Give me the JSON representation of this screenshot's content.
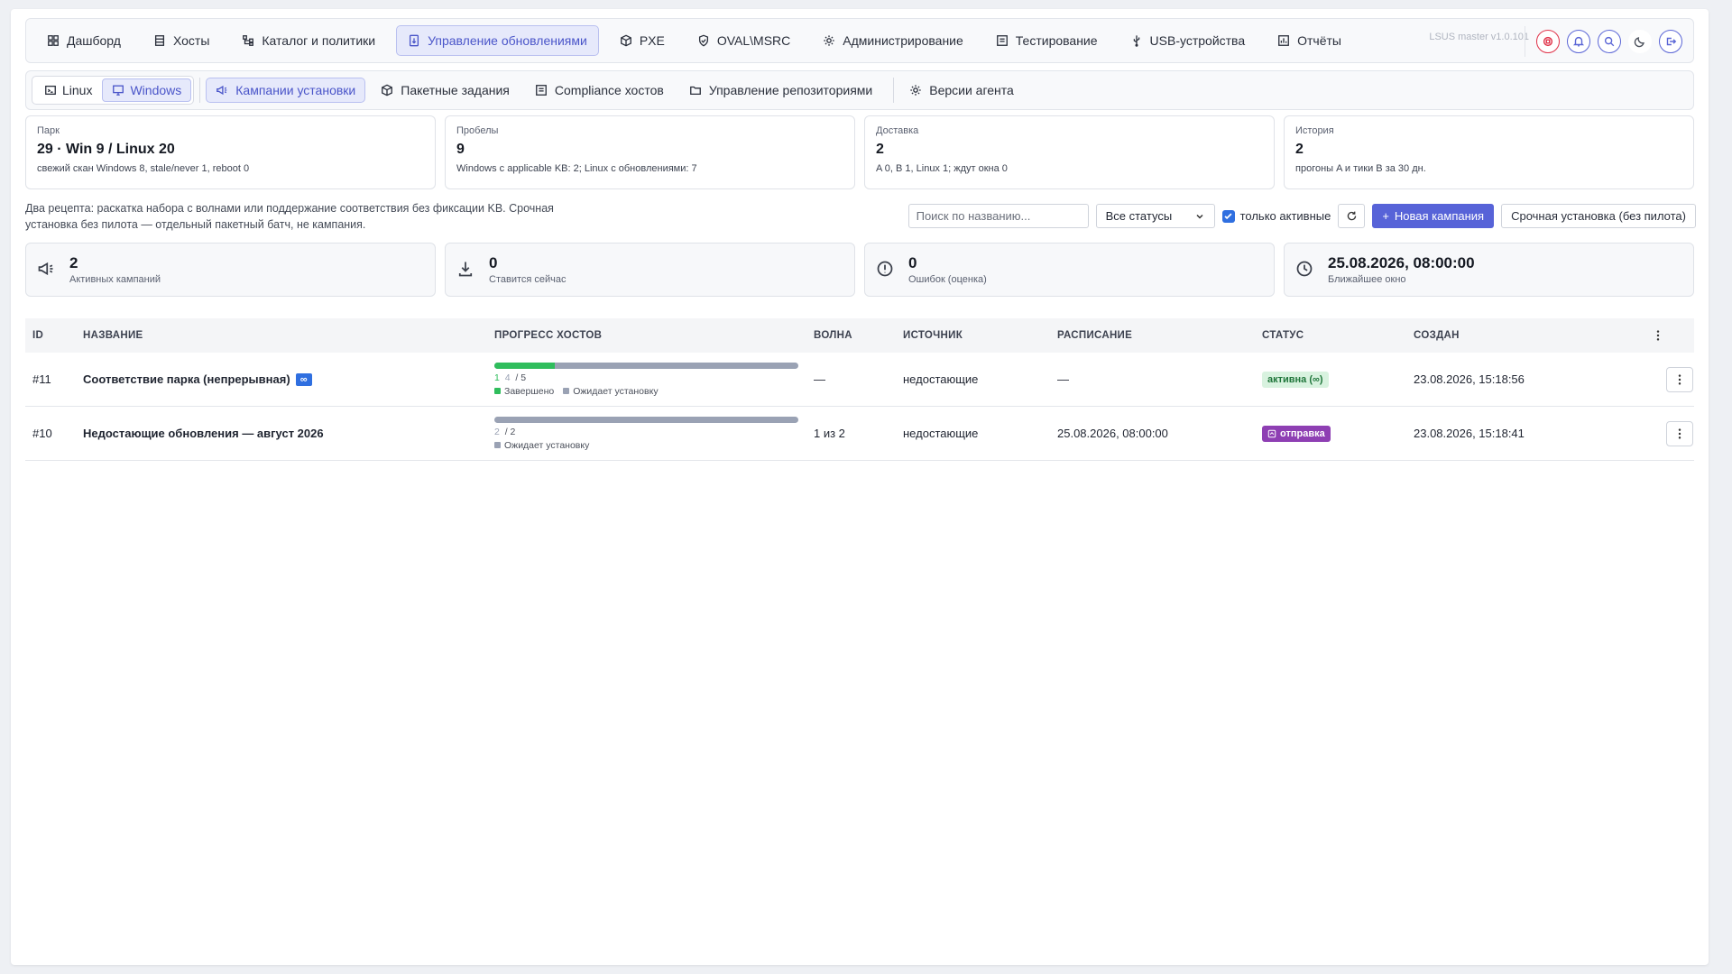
{
  "topnav": {
    "items": [
      {
        "label": "Дашборд",
        "icon": "dashboard-icon"
      },
      {
        "label": "Хосты",
        "icon": "server-icon"
      },
      {
        "label": "Каталог и политики",
        "icon": "sitemap-icon"
      },
      {
        "label": "Управление обновлениями",
        "icon": "update-icon",
        "active": true
      },
      {
        "label": "PXE",
        "icon": "box-icon"
      },
      {
        "label": "OVAL\\MSRC",
        "icon": "shield-icon"
      },
      {
        "label": "Администрирование",
        "icon": "gear-icon"
      },
      {
        "label": "Тестирование",
        "icon": "test-icon"
      },
      {
        "label": "USB-устройства",
        "icon": "usb-icon"
      },
      {
        "label": "Отчёты",
        "icon": "report-icon"
      }
    ],
    "version": "LSUS master v1.0.101"
  },
  "subnav": {
    "os": [
      {
        "label": "Linux",
        "icon": "terminal-icon"
      },
      {
        "label": "Windows",
        "icon": "monitor-icon",
        "active": true
      }
    ],
    "tabs": [
      {
        "label": "Кампании установки",
        "icon": "megaphone-icon",
        "active": true
      },
      {
        "label": "Пакетные задания",
        "icon": "box-icon"
      },
      {
        "label": "Compliance хостов",
        "icon": "list-icon"
      },
      {
        "label": "Управление репозиториями",
        "icon": "folder-icon"
      }
    ],
    "agent_tab": {
      "label": "Версии агента",
      "icon": "gear-icon"
    }
  },
  "cards": [
    {
      "label": "Парк",
      "value": "29 · Win 9 / Linux 20",
      "sub": "свежий скан Windows 8, stale/never 1, reboot 0"
    },
    {
      "label": "Пробелы",
      "value": "9",
      "sub": "Windows с applicable KB: 2; Linux с обновлениями: 7"
    },
    {
      "label": "Доставка",
      "value": "2",
      "sub": "A 0, B 1, Linux 1; ждут окна 0"
    },
    {
      "label": "История",
      "value": "2",
      "sub": "прогоны A и тики B за 30 дн."
    }
  ],
  "description": "Два рецепта: раскатка набора с волнами или поддержание соответствия без фиксации KB. Срочная установка без пилота — отдельный пакетный батч, не кампания.",
  "controls": {
    "search_placeholder": "Поиск по названию...",
    "status_select": "Все статусы",
    "only_active": "только активные",
    "new_campaign": "Новая кампания",
    "urgent_install": "Срочная установка (без пилота)"
  },
  "stats": [
    {
      "value": "2",
      "label": "Активных кампаний",
      "icon": "megaphone-icon"
    },
    {
      "value": "0",
      "label": "Ставится сейчас",
      "icon": "download-icon"
    },
    {
      "value": "0",
      "label": "Ошибок (оценка)",
      "icon": "alert-icon"
    },
    {
      "value": "25.08.2026, 08:00:00",
      "label": "Ближайшее окно",
      "icon": "clock-icon"
    }
  ],
  "table": {
    "headers": {
      "id": "ID",
      "name": "НАЗВАНИЕ",
      "progress": "ПРОГРЕСС ХОСТОВ",
      "wave": "ВОЛНА",
      "source": "ИСТОЧНИК",
      "schedule": "РАСПИСАНИЕ",
      "status": "СТАТУС",
      "created": "СОЗДАН"
    },
    "rows": [
      {
        "id": "#11",
        "name": "Соответствие парка (непрерывная)",
        "badge": "∞",
        "done": "1",
        "pending": "4",
        "total": "/ 5",
        "done_fraction": 0.2,
        "legend_done": "Завершено",
        "legend_pending": "Ожидает установку",
        "wave": "—",
        "source": "недостающие",
        "schedule": "—",
        "status": "активна (∞)",
        "status_color": "green",
        "created": "23.08.2026, 15:18:56"
      },
      {
        "id": "#10",
        "name": "Недостающие обновления — август 2026",
        "badge": "",
        "done": "",
        "pending": "2",
        "total": "/ 2",
        "done_fraction": 0,
        "legend_done": "",
        "legend_pending": "Ожидает установку",
        "wave": "1 из 2",
        "source": "недостающие",
        "schedule": "25.08.2026, 08:00:00",
        "status": "отправка",
        "status_color": "purple",
        "created": "23.08.2026, 15:18:41"
      }
    ]
  },
  "colors": {
    "accent": "#5763d8",
    "done": "#2fbd5c",
    "pending": "#9aa2b4",
    "purple": "#8e3fb3"
  }
}
